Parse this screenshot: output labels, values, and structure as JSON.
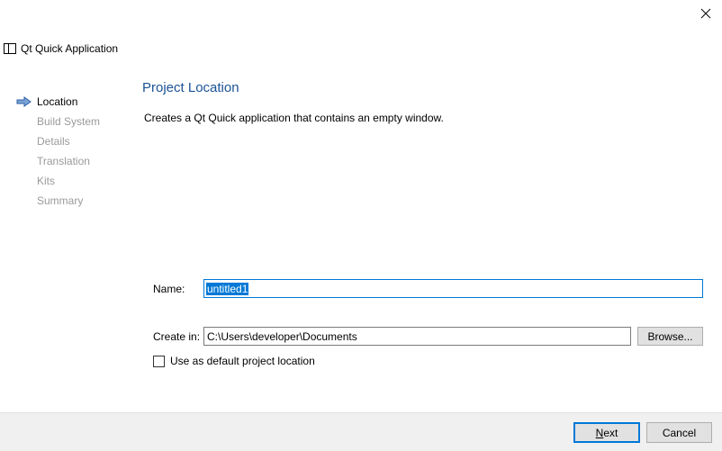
{
  "window": {
    "title": "Qt Quick Application",
    "close_icon": "close-icon",
    "app_icon": "window-icon"
  },
  "sidebar": {
    "current_indicator_icon": "arrow-right-icon",
    "steps": [
      {
        "label": "Location",
        "current": true
      },
      {
        "label": "Build System",
        "current": false
      },
      {
        "label": "Details",
        "current": false
      },
      {
        "label": "Translation",
        "current": false
      },
      {
        "label": "Kits",
        "current": false
      },
      {
        "label": "Summary",
        "current": false
      }
    ]
  },
  "page": {
    "heading": "Project Location",
    "description": "Creates a Qt Quick application that contains an empty window."
  },
  "form": {
    "name_label": "Name:",
    "name_value": "untitled1",
    "create_in_label": "Create in:",
    "create_in_value": "C:\\Users\\developer\\Documents",
    "browse_label": "Browse...",
    "default_location_label": "Use as default project location",
    "default_location_checked": false
  },
  "footer": {
    "next_label": "Next",
    "cancel_label": "Cancel"
  },
  "colors": {
    "heading": "#1b5296",
    "accent": "#0078d7",
    "inactive_step": "#9a9a9a",
    "footer_bg": "#f0f0f0"
  }
}
